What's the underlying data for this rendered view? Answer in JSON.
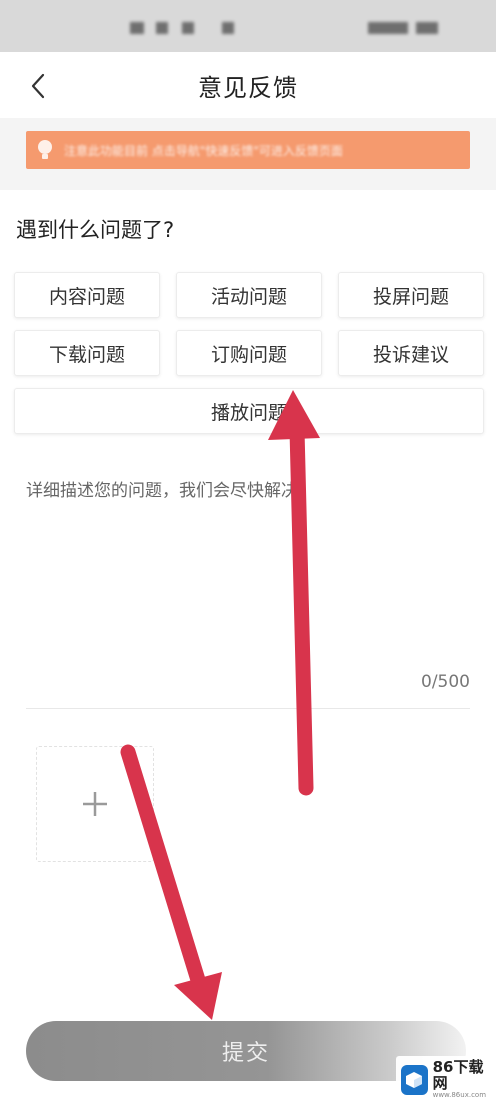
{
  "nav": {
    "title": "意见反馈"
  },
  "notice": {
    "text": "注意此功能目前 点击导航\"快速反馈\"可进入反馈页面"
  },
  "question": {
    "label": "遇到什么问题了?"
  },
  "categories": [
    {
      "label": "内容问题"
    },
    {
      "label": "活动问题"
    },
    {
      "label": "投屏问题"
    },
    {
      "label": "下载问题"
    },
    {
      "label": "订购问题"
    },
    {
      "label": "投诉建议"
    },
    {
      "label": "播放问题"
    }
  ],
  "description": {
    "placeholder": "详细描述您的问题，我们会尽快解决",
    "value": "",
    "counter": "0/500"
  },
  "upload": {
    "icon": "plus-icon"
  },
  "submit": {
    "label": "提交"
  },
  "watermark": {
    "title": "86下载网",
    "url": "www.86ux.com"
  },
  "colors": {
    "notice_bg": "#f59a6e",
    "arrow": "#d8344c",
    "submit_bg": "#8c8c8c"
  }
}
